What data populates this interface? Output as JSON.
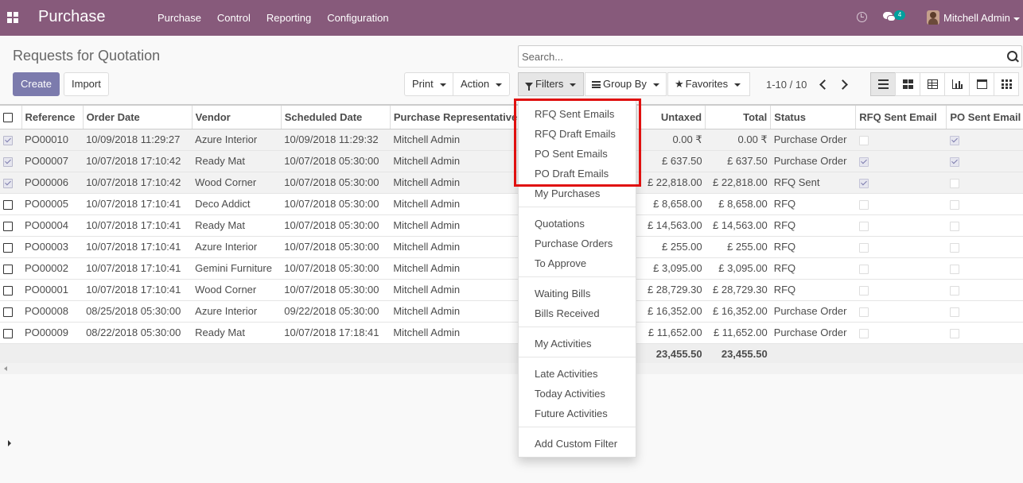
{
  "app": {
    "title": "Purchase"
  },
  "nav": {
    "menu": [
      "Purchase",
      "Control",
      "Reporting",
      "Configuration"
    ],
    "chat_count": "4",
    "user_name": "Mitchell Admin"
  },
  "page": {
    "breadcrumb": "Requests for Quotation",
    "create_label": "Create",
    "import_label": "Import",
    "print_label": "Print",
    "action_label": "Action"
  },
  "search": {
    "placeholder": "Search...",
    "filters_label": "Filters",
    "groupby_label": "Group By",
    "favorites_label": "Favorites"
  },
  "pager": {
    "text": "1-10 / 10"
  },
  "views": [
    "list-view-icon",
    "kanban-view-icon",
    "grid-view-icon",
    "graph-view-icon",
    "calendar-view-icon",
    "pivot-view-icon"
  ],
  "table": {
    "columns": [
      "Reference",
      "Order Date",
      "Vendor",
      "Scheduled Date",
      "Purchase Representative",
      "Untaxed",
      "Total",
      "Status",
      "RFQ Sent Email",
      "PO Sent Email"
    ],
    "rows": [
      {
        "selected": true,
        "ref": "PO00010",
        "order_date": "10/09/2018 11:29:27",
        "vendor": "Azure Interior",
        "scheduled": "10/09/2018 11:29:32",
        "rep": "Mitchell Admin",
        "untaxed": "0.00 ₹",
        "total": "0.00 ₹",
        "status": "Purchase Order",
        "rfq_sent": false,
        "po_sent": true
      },
      {
        "selected": true,
        "ref": "PO00007",
        "order_date": "10/07/2018 17:10:42",
        "vendor": "Ready Mat",
        "scheduled": "10/07/2018 05:30:00",
        "rep": "Mitchell Admin",
        "untaxed": "£ 637.50",
        "total": "£ 637.50",
        "status": "Purchase Order",
        "rfq_sent": true,
        "po_sent": true
      },
      {
        "selected": true,
        "ref": "PO00006",
        "order_date": "10/07/2018 17:10:42",
        "vendor": "Wood Corner",
        "scheduled": "10/07/2018 05:30:00",
        "rep": "Mitchell Admin",
        "untaxed": "£ 22,818.00",
        "total": "£ 22,818.00",
        "status": "RFQ Sent",
        "rfq_sent": true,
        "po_sent": false
      },
      {
        "selected": false,
        "ref": "PO00005",
        "order_date": "10/07/2018 17:10:41",
        "vendor": "Deco Addict",
        "scheduled": "10/07/2018 05:30:00",
        "rep": "Mitchell Admin",
        "untaxed": "£ 8,658.00",
        "total": "£ 8,658.00",
        "status": "RFQ",
        "rfq_sent": false,
        "po_sent": false
      },
      {
        "selected": false,
        "ref": "PO00004",
        "order_date": "10/07/2018 17:10:41",
        "vendor": "Ready Mat",
        "scheduled": "10/07/2018 05:30:00",
        "rep": "Mitchell Admin",
        "untaxed": "£ 14,563.00",
        "total": "£ 14,563.00",
        "status": "RFQ",
        "rfq_sent": false,
        "po_sent": false
      },
      {
        "selected": false,
        "ref": "PO00003",
        "order_date": "10/07/2018 17:10:41",
        "vendor": "Azure Interior",
        "scheduled": "10/07/2018 05:30:00",
        "rep": "Mitchell Admin",
        "untaxed": "£ 255.00",
        "total": "£ 255.00",
        "status": "RFQ",
        "rfq_sent": false,
        "po_sent": false
      },
      {
        "selected": false,
        "ref": "PO00002",
        "order_date": "10/07/2018 17:10:41",
        "vendor": "Gemini Furniture",
        "scheduled": "10/07/2018 05:30:00",
        "rep": "Mitchell Admin",
        "untaxed": "£ 3,095.00",
        "total": "£ 3,095.00",
        "status": "RFQ",
        "rfq_sent": false,
        "po_sent": false
      },
      {
        "selected": false,
        "ref": "PO00001",
        "order_date": "10/07/2018 17:10:41",
        "vendor": "Wood Corner",
        "scheduled": "10/07/2018 05:30:00",
        "rep": "Mitchell Admin",
        "untaxed": "£ 28,729.30",
        "total": "£ 28,729.30",
        "status": "RFQ",
        "rfq_sent": false,
        "po_sent": false
      },
      {
        "selected": false,
        "ref": "PO00008",
        "order_date": "08/25/2018 05:30:00",
        "vendor": "Azure Interior",
        "scheduled": "09/22/2018 05:30:00",
        "rep": "Mitchell Admin",
        "untaxed": "£ 16,352.00",
        "total": "£ 16,352.00",
        "status": "Purchase Order",
        "rfq_sent": false,
        "po_sent": false
      },
      {
        "selected": false,
        "ref": "PO00009",
        "order_date": "08/22/2018 05:30:00",
        "vendor": "Ready Mat",
        "scheduled": "10/07/2018 17:18:41",
        "rep": "Mitchell Admin",
        "untaxed": "£ 11,652.00",
        "total": "£ 11,652.00",
        "status": "Purchase Order",
        "rfq_sent": false,
        "po_sent": false
      }
    ],
    "totals": {
      "untaxed": "23,455.50",
      "total": "23,455.50"
    }
  },
  "filters_menu": {
    "groups": [
      [
        "RFQ Sent Emails",
        "RFQ Draft Emails",
        "PO Sent Emails",
        "PO Draft Emails",
        "My Purchases"
      ],
      [
        "Quotations",
        "Purchase Orders",
        "To Approve"
      ],
      [
        "Waiting Bills",
        "Bills Received"
      ],
      [
        "My Activities"
      ],
      [
        "Late Activities",
        "Today Activities",
        "Future Activities"
      ]
    ],
    "custom_filter": "Add Custom Filter"
  },
  "colors": {
    "navbar": "#875a7b",
    "primary": "#7c7bad",
    "badge": "#00a09d",
    "highlight": "#e0100f"
  }
}
